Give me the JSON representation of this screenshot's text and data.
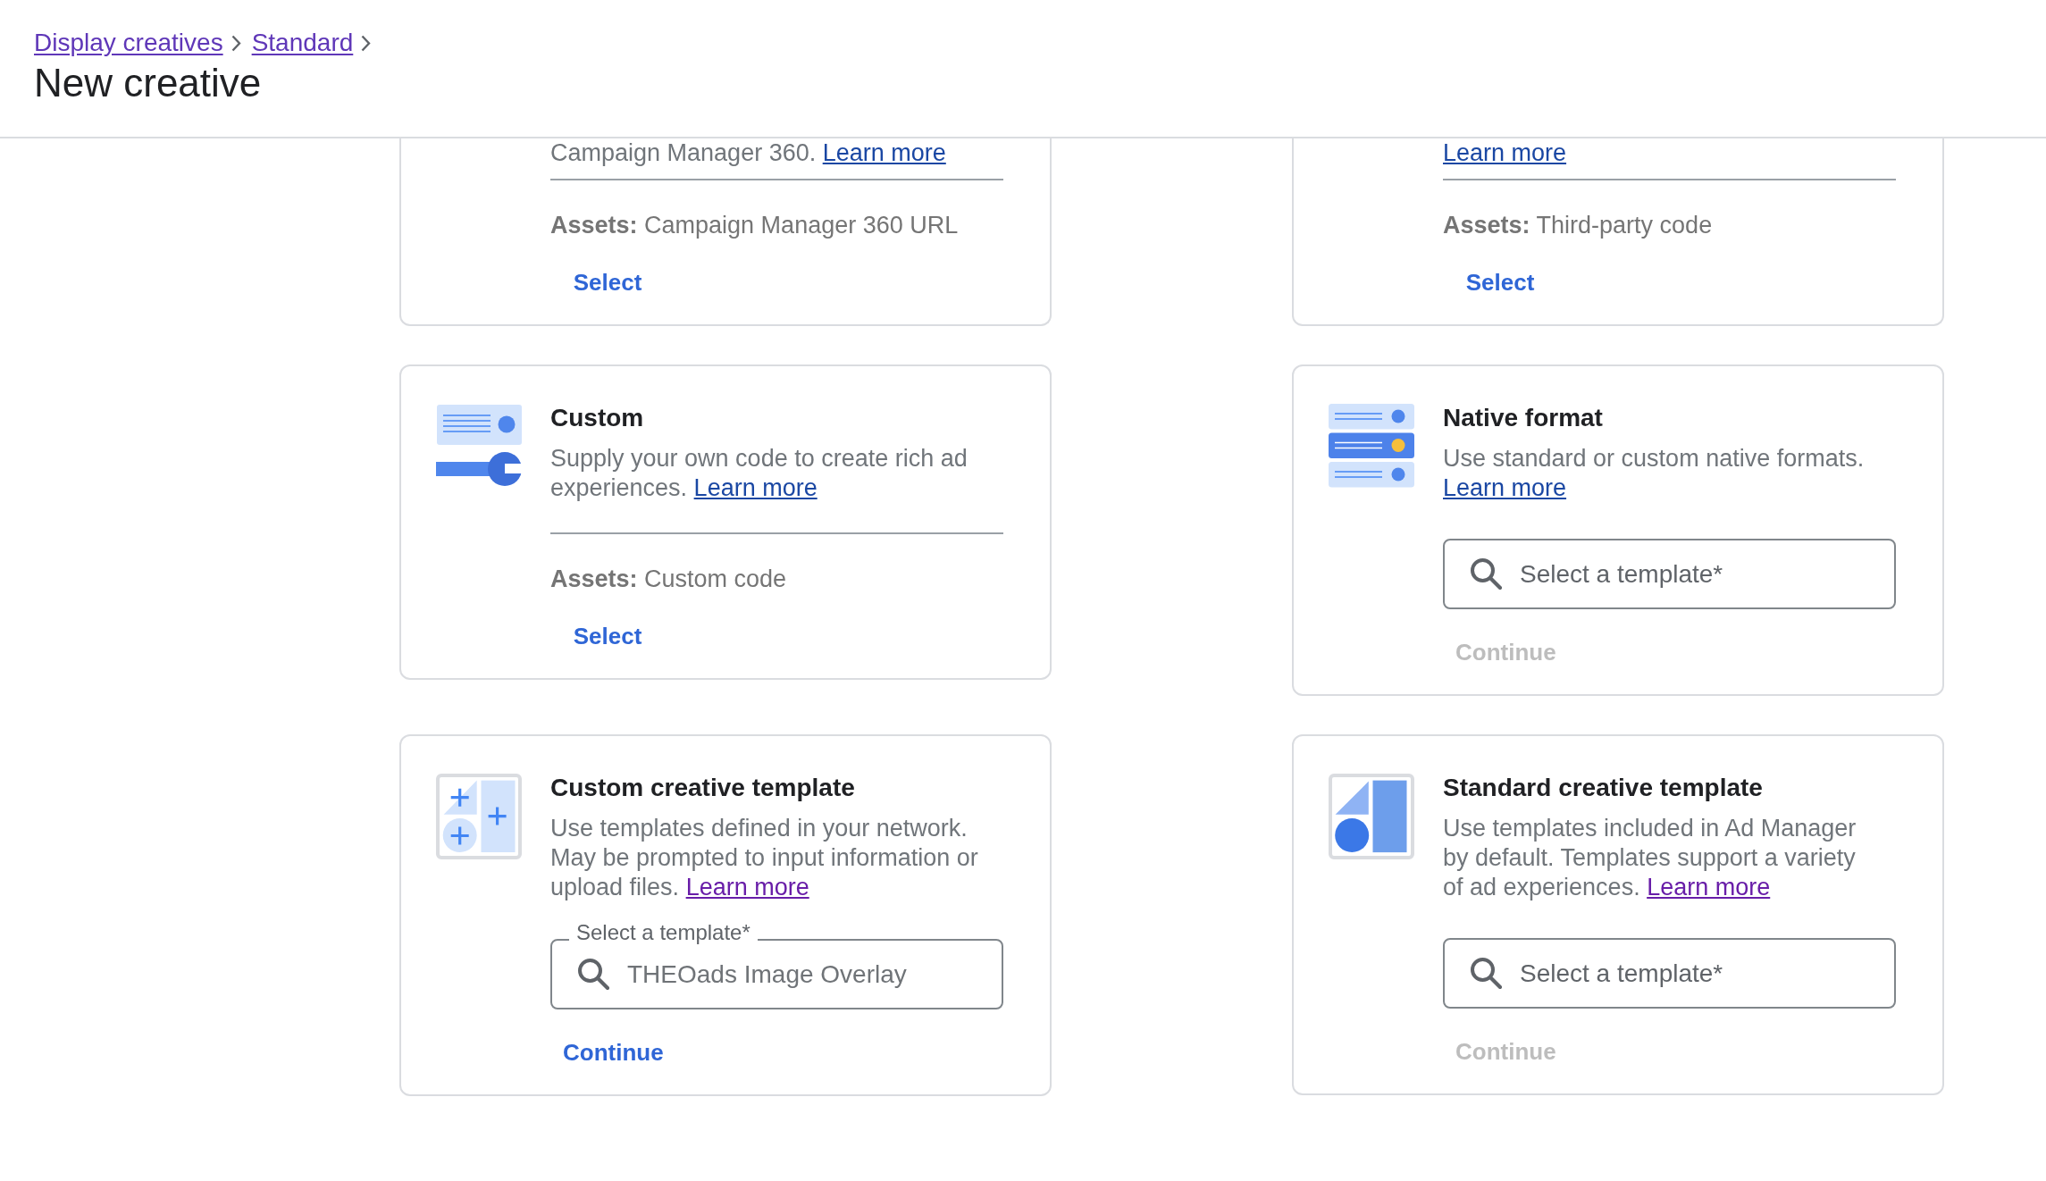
{
  "breadcrumb": [
    {
      "label": "Display creatives",
      "visited": true
    },
    {
      "label": "Standard",
      "visited": true
    }
  ],
  "page_title": "New creative",
  "cards": [
    {
      "kind": "assets",
      "clipped_top": true,
      "description": "Campaign Manager 360.",
      "learn_more": {
        "label": "Learn more",
        "visited": false
      },
      "assets": "**Assets:** Campaign Manager 360 URL",
      "action": {
        "label": "Select",
        "disabled": false
      }
    },
    {
      "kind": "assets",
      "clipped_top": true,
      "learn_more": {
        "label": "Learn more",
        "visited": false
      },
      "assets": "**Assets:** Third-party code",
      "action": {
        "label": "Select",
        "disabled": false
      }
    },
    {
      "kind": "assets",
      "clipped_top": false,
      "title": "Custom",
      "description": "Supply your own code to create rich ad experiences.",
      "learn_more": {
        "label": "Learn more",
        "visited": false
      },
      "assets": "**Assets:** Custom code",
      "action": {
        "label": "Select",
        "disabled": false
      }
    },
    {
      "kind": "template",
      "clipped_top": false,
      "title": "Native format",
      "description": "Use standard or custom native formats.",
      "learn_more": {
        "label": "Learn more",
        "visited": false
      },
      "template_field": {
        "placeholder": "Select a template*"
      },
      "action": {
        "label": "Continue",
        "disabled": true
      }
    },
    {
      "kind": "template",
      "clipped_top": false,
      "title": "Custom creative template",
      "description": "Use templates defined in your network. May be prompted to input information or upload files.",
      "learn_more": {
        "label": "Learn more",
        "visited": true
      },
      "template_field": {
        "label": "Select a template*",
        "value": "THEOads Image Overlay"
      },
      "action": {
        "label": "Continue",
        "disabled": false
      }
    },
    {
      "kind": "template",
      "clipped_top": false,
      "title": "Standard creative template",
      "description": "Use templates included in Ad Manager by default. Templates support a variety of ad experiences.",
      "learn_more": {
        "label": "Learn more",
        "visited": true
      },
      "template_field": {
        "placeholder": "Select a template*"
      },
      "action": {
        "label": "Continue",
        "disabled": true
      }
    }
  ]
}
